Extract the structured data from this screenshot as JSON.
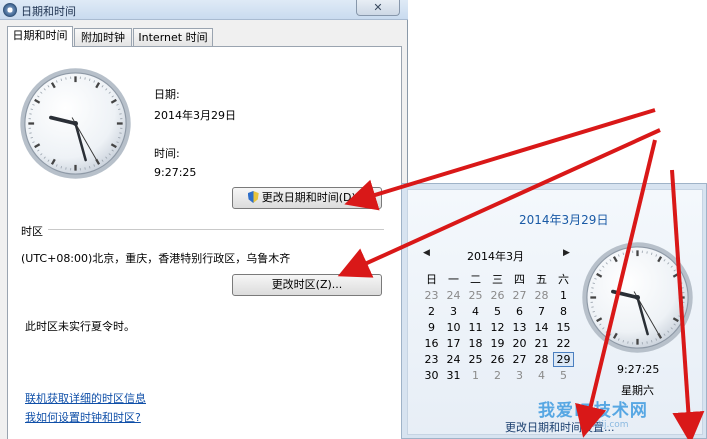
{
  "window": {
    "title": "日期和时间",
    "close_glyph": "✕"
  },
  "tabs": [
    {
      "label": "日期和时间",
      "active": true
    },
    {
      "label": "附加时钟",
      "active": false
    },
    {
      "label": "Internet 时间",
      "active": false
    }
  ],
  "date_section": {
    "date_label": "日期:",
    "date_value": "2014年3月29日",
    "time_label": "时间:",
    "time_value": "9:27:25",
    "change_button": "更改日期和时间(D)..."
  },
  "timezone_section": {
    "heading": "时区",
    "value": "(UTC+08:00)北京，重庆，香港特别行政区，乌鲁木齐",
    "change_button": "更改时区(Z)...",
    "dst_note": "此时区未实行夏令时。"
  },
  "links": {
    "online_info": "联机获取详细的时区信息",
    "how_to": "我如何设置时钟和时区?"
  },
  "flyout": {
    "date_heading": "2014年3月29日",
    "month_label": "2014年3月",
    "prev_glyph": "◀",
    "next_glyph": "▶",
    "weekdays": [
      "日",
      "一",
      "二",
      "三",
      "四",
      "五",
      "六"
    ],
    "weeks": [
      [
        "23",
        "24",
        "25",
        "26",
        "27",
        "28",
        "1"
      ],
      [
        "2",
        "3",
        "4",
        "5",
        "6",
        "7",
        "8"
      ],
      [
        "9",
        "10",
        "11",
        "12",
        "13",
        "14",
        "15"
      ],
      [
        "16",
        "17",
        "18",
        "19",
        "20",
        "21",
        "22"
      ],
      [
        "23",
        "24",
        "25",
        "26",
        "27",
        "28",
        "29"
      ],
      [
        "30",
        "31",
        "1",
        "2",
        "3",
        "4",
        "5"
      ]
    ],
    "dim_days": {
      "first_week_until": 6,
      "last_week_from": 2
    },
    "today": "29",
    "time": "9:27:25",
    "weekday": "星期六",
    "change_link": "更改日期和时间设置..."
  },
  "clock": {
    "hour": 9,
    "minute": 27,
    "second": 25
  },
  "watermark": {
    "text": "我爱IT技术网",
    "sub": "52ij.com"
  },
  "colors": {
    "arrow": "#d91818",
    "accent": "#1a5aa6",
    "link": "#0f4fa8"
  }
}
